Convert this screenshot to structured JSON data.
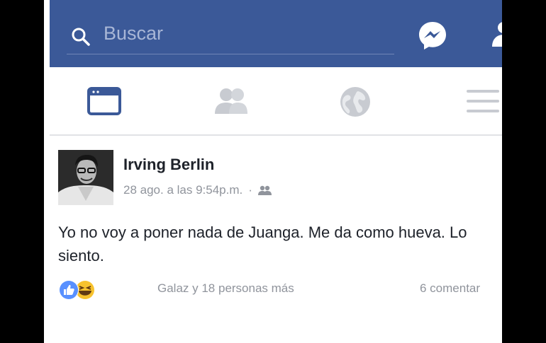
{
  "search": {
    "placeholder": "Buscar"
  },
  "post": {
    "author": "Irving Berlin",
    "timestamp": "28 ago. a las 9:54p.m.",
    "separator": "·",
    "privacy_icon": "friends-icon",
    "text": "Yo no voy a poner nada de Juanga. Me da como hueva. Lo siento.",
    "likers": "Galaz y 18 personas más",
    "comments": "6 comentar",
    "reactions": [
      "like-icon",
      "haha-icon"
    ]
  },
  "tabs": [
    "news-feed-icon",
    "friends-icon",
    "globe-icon",
    "menu-icon"
  ],
  "colors": {
    "brand": "#3b5998",
    "tab_active": "#3b5998",
    "tab_inactive": "#c8cbd1"
  }
}
